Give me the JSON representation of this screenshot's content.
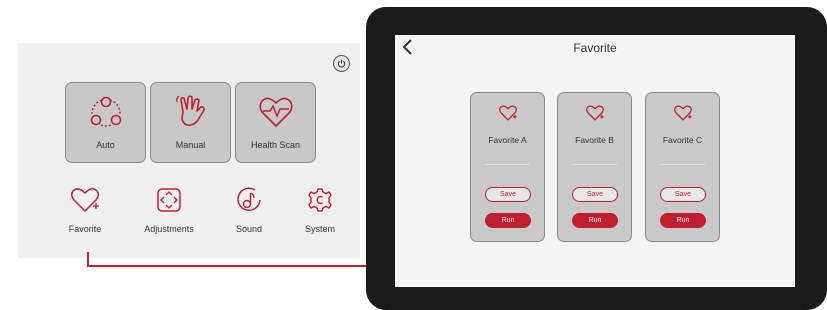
{
  "home": {
    "tiles": [
      {
        "label": "Auto",
        "icon": "auto-icon"
      },
      {
        "label": "Manual",
        "icon": "hand-icon"
      },
      {
        "label": "Health Scan",
        "icon": "heart-pulse-icon"
      }
    ],
    "nav": [
      {
        "label": "Favorite",
        "icon": "heart-plus-icon"
      },
      {
        "label": "Adjustments",
        "icon": "adjust-icon"
      },
      {
        "label": "Sound",
        "icon": "music-note-icon"
      },
      {
        "label": "System",
        "icon": "gear-icon"
      }
    ],
    "power_icon": "power-icon"
  },
  "favorite_screen": {
    "title": "Favorite",
    "cards": [
      {
        "name": "Favorite A",
        "save_label": "Save",
        "run_label": "Run"
      },
      {
        "name": "Favorite B",
        "save_label": "Save",
        "run_label": "Run"
      },
      {
        "name": "Favorite C",
        "save_label": "Save",
        "run_label": "Run"
      }
    ]
  },
  "colors": {
    "accent": "#c01f2f",
    "tile_bg": "#c8c8c8",
    "panel_bg": "#efefef",
    "tablet_bezel": "#1b1b1b"
  }
}
